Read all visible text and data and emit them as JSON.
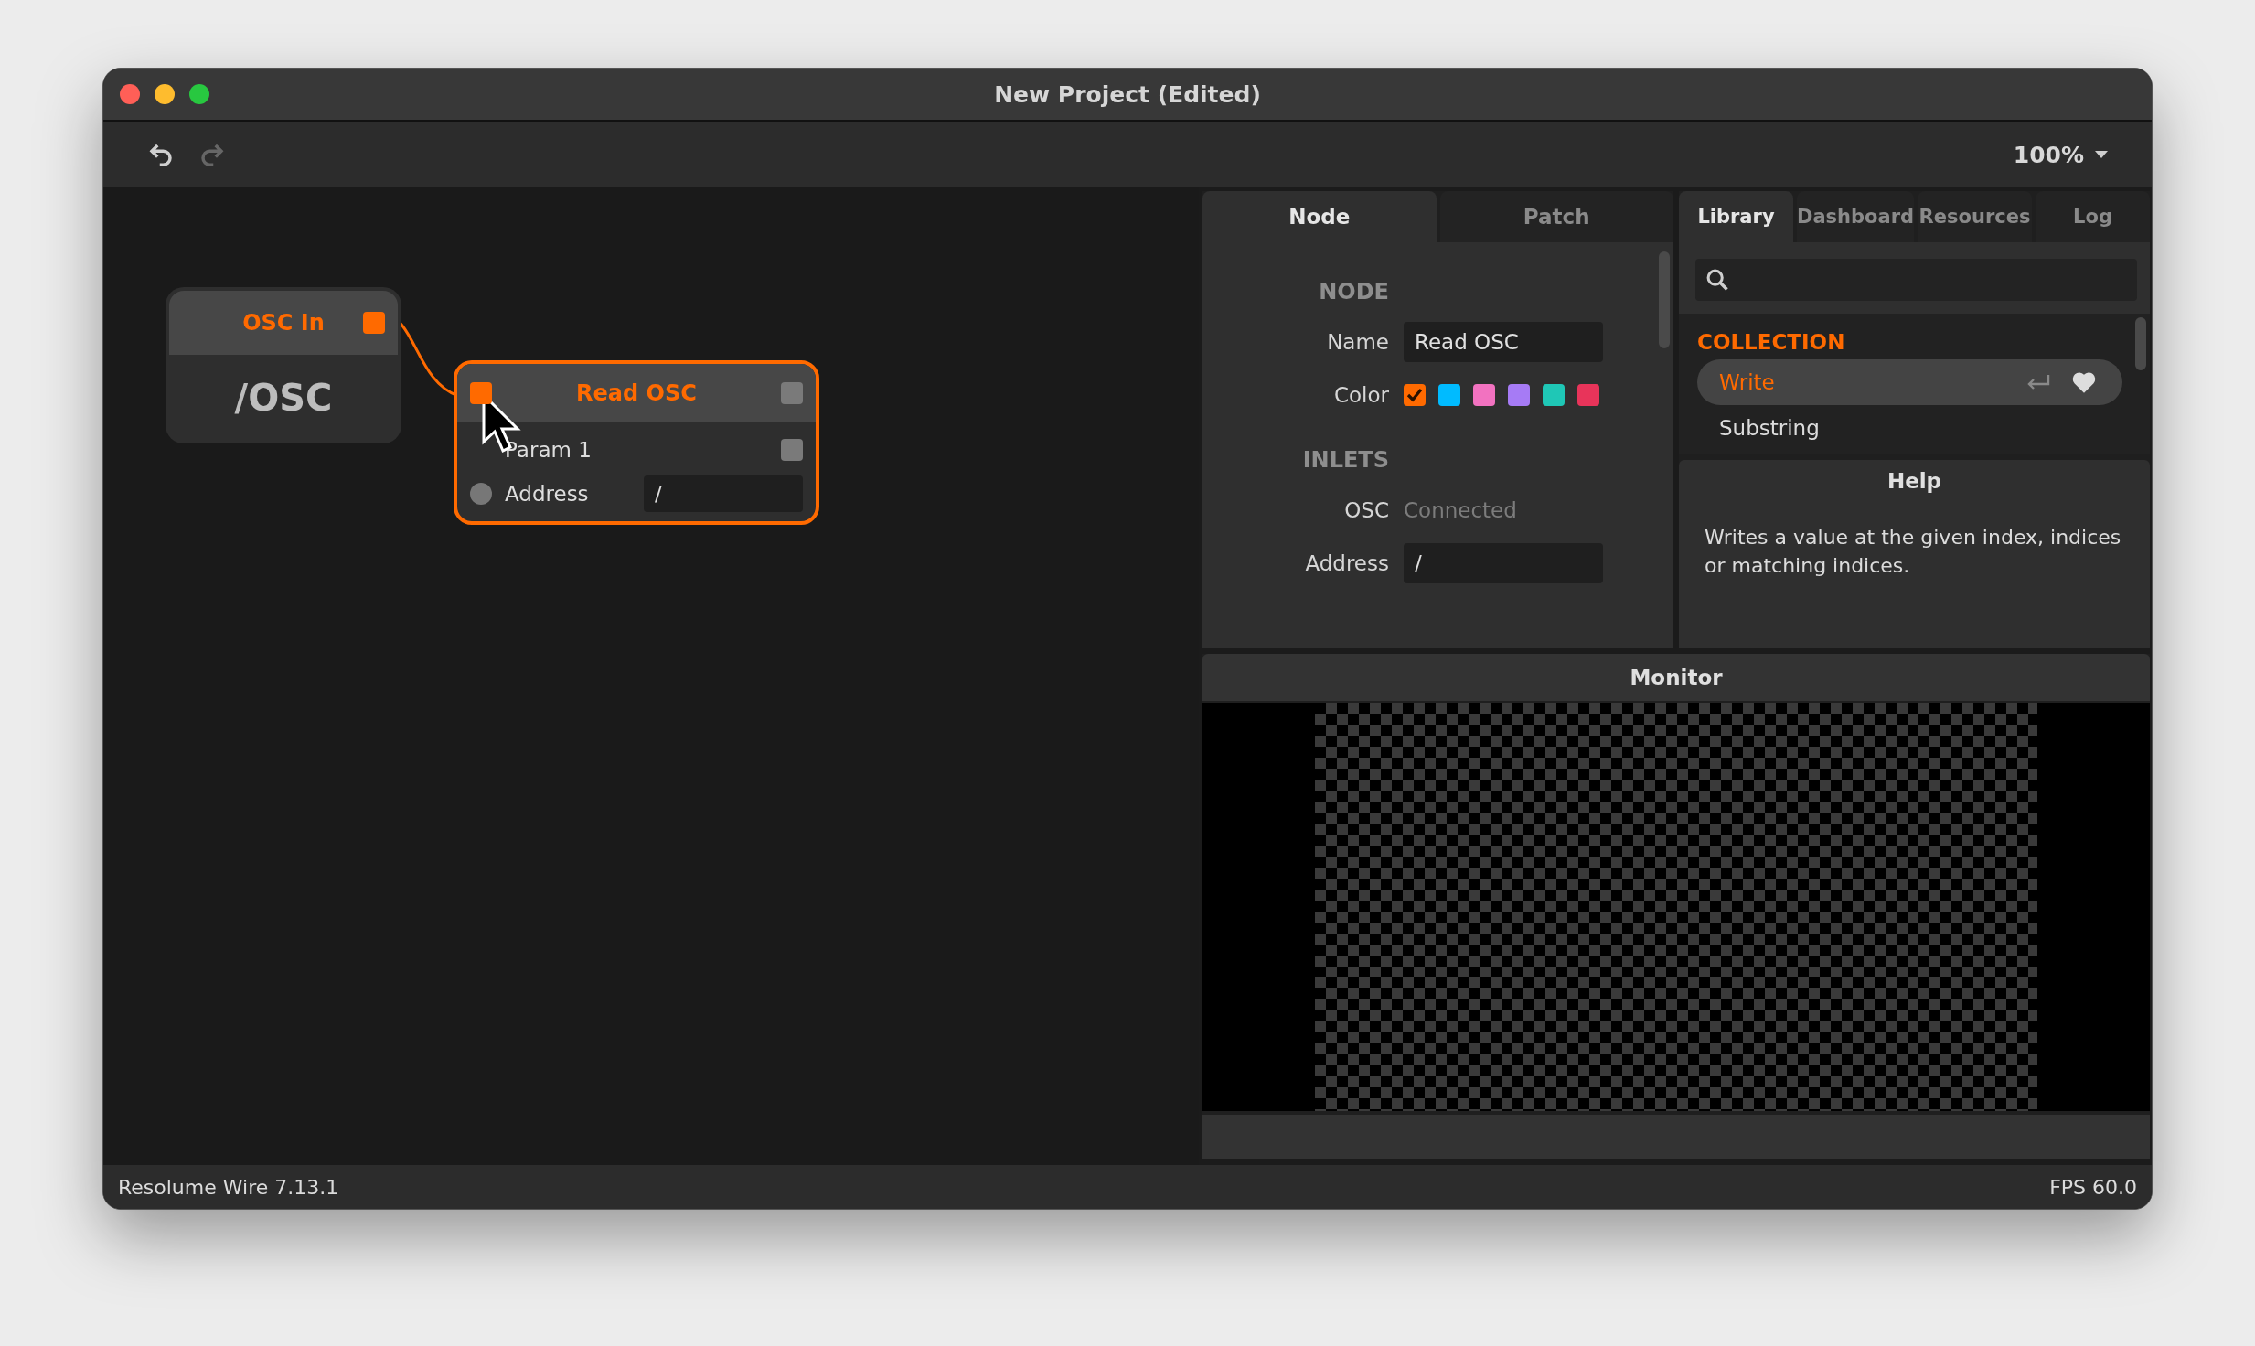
{
  "window": {
    "title": "New Project (Edited)"
  },
  "toolbar": {
    "zoom": "100%"
  },
  "canvas": {
    "nodes": [
      {
        "kind": "value",
        "title": "OSC In",
        "value": "/OSC",
        "selected": false
      },
      {
        "kind": "function",
        "title": "Read OSC",
        "selected": true,
        "rows": [
          {
            "kind": "outlet",
            "label": "Param 1"
          },
          {
            "kind": "input",
            "label": "Address",
            "value": "/"
          }
        ]
      }
    ]
  },
  "inspector": {
    "tabs": [
      {
        "label": "Node",
        "selected": true
      },
      {
        "label": "Patch",
        "selected": false
      }
    ],
    "sections": [
      {
        "title": "NODE",
        "fields": [
          {
            "kind": "text",
            "label": "Name",
            "value": "Read OSC"
          },
          {
            "kind": "colors",
            "label": "Color",
            "swatches": [
              {
                "color": "#ff6a00",
                "selected": true
              },
              {
                "color": "#00bbff",
                "selected": false
              },
              {
                "color": "#f272c0",
                "selected": false
              },
              {
                "color": "#a67bf5",
                "selected": false
              },
              {
                "color": "#1fc7b6",
                "selected": false
              },
              {
                "color": "#e8345a",
                "selected": false
              }
            ]
          }
        ]
      },
      {
        "title": "INLETS",
        "fields": [
          {
            "kind": "status",
            "label": "OSC",
            "value": "Connected"
          },
          {
            "kind": "text",
            "label": "Address",
            "value": "/"
          }
        ]
      }
    ]
  },
  "library": {
    "tabs": [
      {
        "label": "Library",
        "selected": true
      },
      {
        "label": "Dashboard",
        "selected": false
      },
      {
        "label": "Resources",
        "selected": false
      },
      {
        "label": "Log",
        "selected": false
      }
    ],
    "category": "COLLECTION",
    "items": [
      {
        "label": "Write",
        "selected": true
      },
      {
        "label": "Substring",
        "selected": false
      }
    ]
  },
  "help": {
    "title": "Help",
    "text": "Writes a value at the given index, indices or matching indices."
  },
  "monitor": {
    "title": "Monitor"
  },
  "status_bar": {
    "left": "Resolume Wire 7.13.1",
    "right": "FPS 60.0"
  }
}
